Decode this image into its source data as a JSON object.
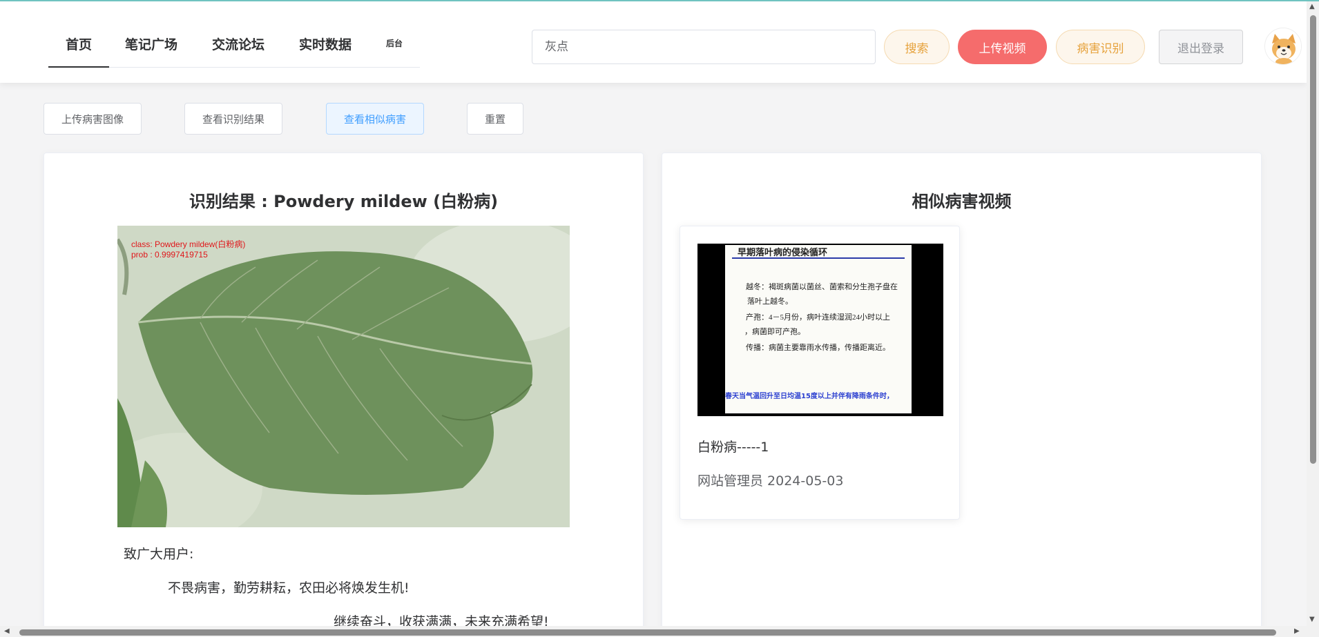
{
  "nav": {
    "items": [
      {
        "label": "首页",
        "active": true
      },
      {
        "label": "笔记广场"
      },
      {
        "label": "交流论坛"
      },
      {
        "label": "实时数据"
      },
      {
        "label": "后台"
      }
    ]
  },
  "search": {
    "value": "灰点"
  },
  "buttons": {
    "search": "搜索",
    "upload_video": "上传视频",
    "identify": "病害识别",
    "logout": "退出登录"
  },
  "toolbar": {
    "upload_image": "上传病害图像",
    "view_result": "查看识别结果",
    "view_similar": "查看相似病害",
    "reset": "重置"
  },
  "result": {
    "title": "识别结果 : Powdery mildew (白粉病)",
    "overlay_class": "class: Powdery mildew(白粉病)",
    "overlay_prob": "prob : 0.9997419715",
    "greeting": "致广大用户:",
    "line1": "不畏病害，勤劳耕耘，农田必将焕发生机!",
    "line2": "继续奋斗，收获满满，未来充满希望!"
  },
  "similar": {
    "title": "相似病害视频",
    "videos": [
      {
        "title": "白粉病-----1",
        "meta": "网站管理员 2024-05-03",
        "slide": {
          "heading": "早期落叶病的侵染循环",
          "lines": [
            "越冬：褐斑病菌以菌丝、菌索和分生孢子盘在",
            "落叶上越冬。",
            "产孢：4－5月份，病叶连续湿润24小时以上",
            "，病菌即可产孢。",
            "传播：病菌主要靠雨水传播，传播距离近。"
          ],
          "footer": "春天当气温回升至日均温15度以上并伴有降雨条件时，"
        }
      }
    ]
  },
  "colors": {
    "accent_red": "#f56c6c",
    "warning": "#e6a23c",
    "primary": "#409eff"
  }
}
